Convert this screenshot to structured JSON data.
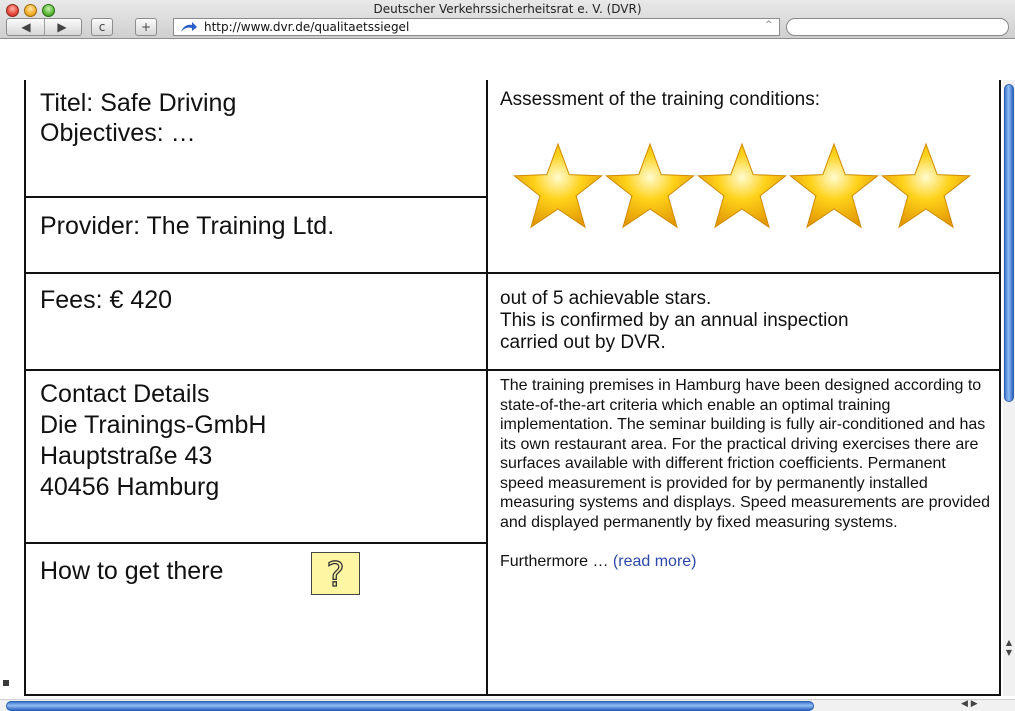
{
  "window": {
    "title": "Deutscher Verkehrssicherheitsrat e. V. (DVR)",
    "url": "http://www.dvr.de/qualitaetssiegel",
    "back_label": "◀",
    "forward_label": "▶",
    "reload_label": "c",
    "add_label": "+",
    "url_dropdown_icon": "^"
  },
  "course": {
    "title_line": "Titel: Safe Driving",
    "objectives_line": "Objectives: …",
    "provider_line": "Provider: The Training Ltd.",
    "fees_line": "Fees: € 420"
  },
  "contact": {
    "heading": "Contact Details",
    "company": "Die Trainings-GmbH",
    "street": "Hauptstraße 43",
    "city": "40456 Hamburg"
  },
  "directions": {
    "label": "How to get there",
    "help_icon": "question-mark-icon",
    "help_glyph": "?"
  },
  "assessment": {
    "heading": "Assessment of the training conditions:",
    "stars_awarded": 5,
    "stars_max": 5,
    "line1": "out of 5 achievable stars.",
    "line2": "This is confirmed by an annual inspection",
    "line3": "carried out by DVR."
  },
  "description": {
    "text": "The training premises in Hamburg have been designed according to state-of-the-art criteria which enable an optimal training implementation. The seminar building is fully air-conditioned and has its own restaurant area. For the practical driving exercises there are surfaces available with different friction coefficients. Permanent speed measurement is provided for by permanently installed measuring systems and displays. Speed measurements are provided and displayed permanently by fixed measuring systems.",
    "more_prefix": "Furthermore …",
    "read_more": "(read more)"
  },
  "colors": {
    "star_fill": "#ffd21a",
    "help_bg": "#fff6a3",
    "link": "#2b49a8"
  }
}
